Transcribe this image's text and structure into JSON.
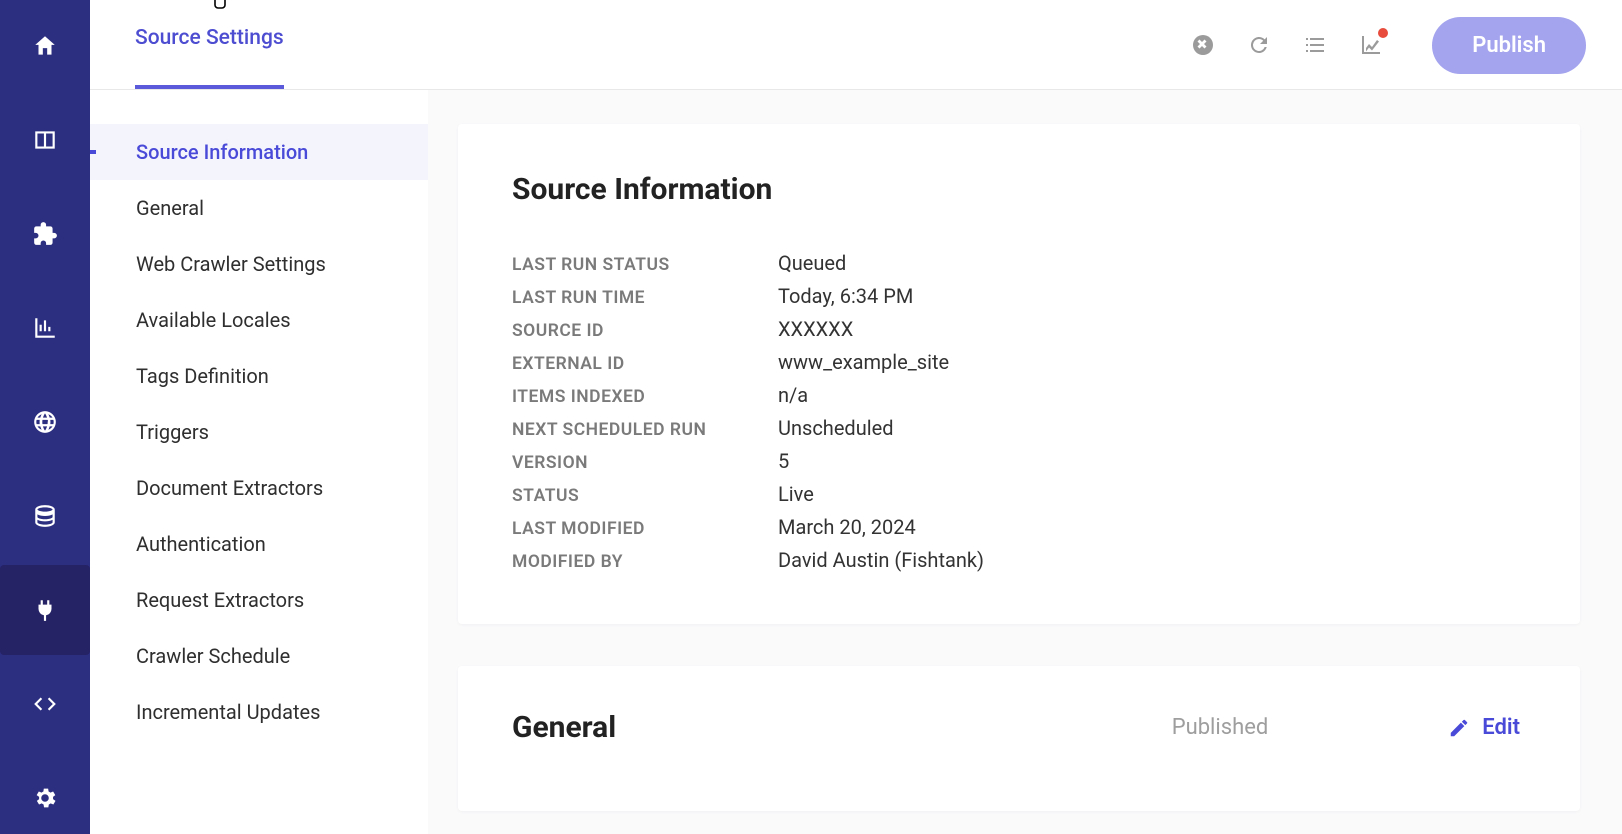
{
  "rail": {
    "icons": [
      "home",
      "panel",
      "puzzle",
      "bar-chart",
      "globe",
      "database",
      "plug",
      "code",
      "gear"
    ],
    "active_index": 6
  },
  "header": {
    "tab_label": "Source Settings",
    "publish_label": "Publish"
  },
  "section_nav": {
    "items": [
      "Source Information",
      "General",
      "Web Crawler Settings",
      "Available Locales",
      "Tags Definition",
      "Triggers",
      "Document Extractors",
      "Authentication",
      "Request Extractors",
      "Crawler Schedule",
      "Incremental Updates"
    ],
    "active_index": 0
  },
  "source_info": {
    "heading": "Source Information",
    "rows": [
      {
        "label": "LAST RUN STATUS",
        "value": "Queued"
      },
      {
        "label": "LAST RUN TIME",
        "value": "Today, 6:34 PM"
      },
      {
        "label": "SOURCE ID",
        "value": "XXXXXX"
      },
      {
        "label": "EXTERNAL ID",
        "value": "www_example_site"
      },
      {
        "label": "ITEMS INDEXED",
        "value": "n/a"
      },
      {
        "label": "NEXT SCHEDULED RUN",
        "value": "Unscheduled"
      },
      {
        "label": "VERSION",
        "value": "5"
      },
      {
        "label": "STATUS",
        "value": "Live"
      },
      {
        "label": "LAST MODIFIED",
        "value": "March 20, 2024"
      },
      {
        "label": "MODIFIED BY",
        "value": "David Austin (Fishtank)"
      }
    ]
  },
  "general_card": {
    "heading": "General",
    "status_label": "Published",
    "edit_label": "Edit"
  }
}
